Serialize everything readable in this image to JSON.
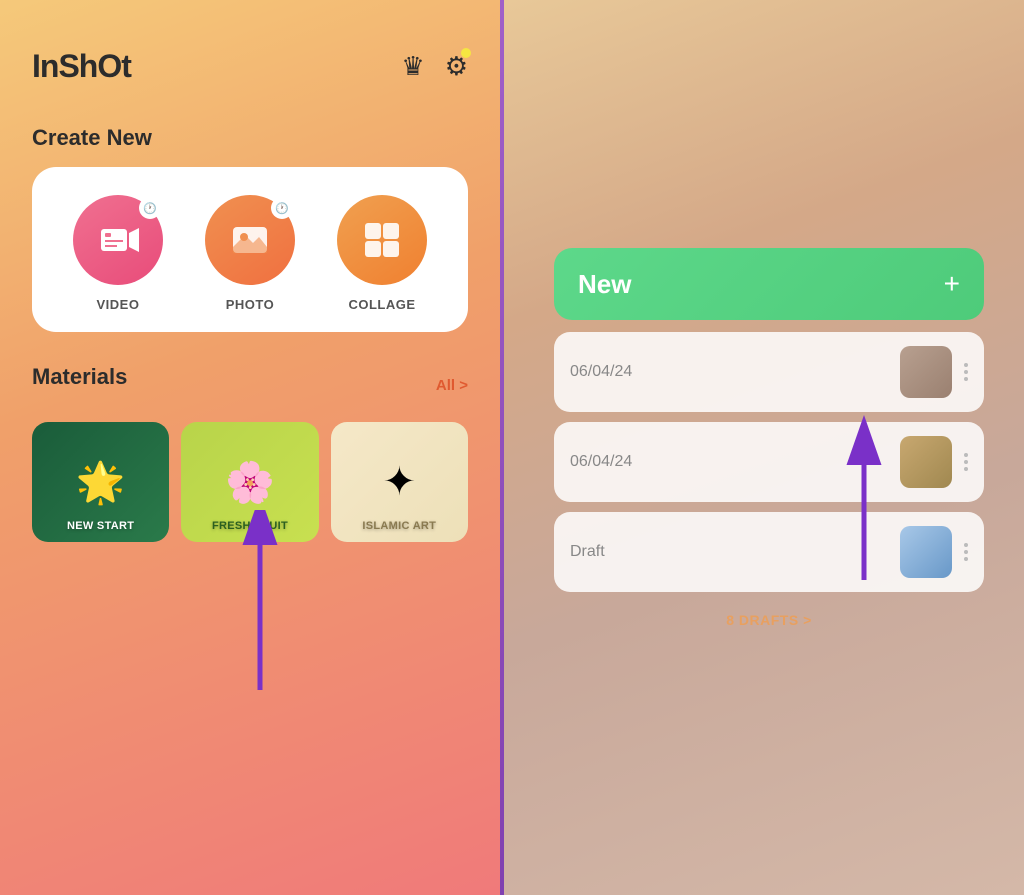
{
  "app": {
    "logo": "InShOt",
    "crown_icon": "♛",
    "gear_icon": "⚙",
    "has_notification": true
  },
  "left": {
    "create_section": {
      "title": "Create New",
      "items": [
        {
          "id": "video",
          "label": "VIDEO",
          "has_clock": true
        },
        {
          "id": "photo",
          "label": "PHOTO",
          "has_clock": true
        },
        {
          "id": "collage",
          "label": "COLLAGE",
          "has_clock": false
        }
      ]
    },
    "materials_section": {
      "title": "Materials",
      "all_label": "All >",
      "items": [
        {
          "id": "new-start",
          "label": "NEW START"
        },
        {
          "id": "fresh-fruit",
          "label": "FRESH FRUIT"
        },
        {
          "id": "islamic-art",
          "label": "ISLAMIC ART"
        }
      ]
    }
  },
  "right": {
    "new_button": {
      "label": "New",
      "plus": "+"
    },
    "drafts": [
      {
        "date": "06/04/24",
        "is_draft": false
      },
      {
        "date": "06/04/24",
        "is_draft": false
      },
      {
        "date": "Draft",
        "is_draft": true
      }
    ],
    "drafts_footer": "8 DRAFTS >"
  }
}
